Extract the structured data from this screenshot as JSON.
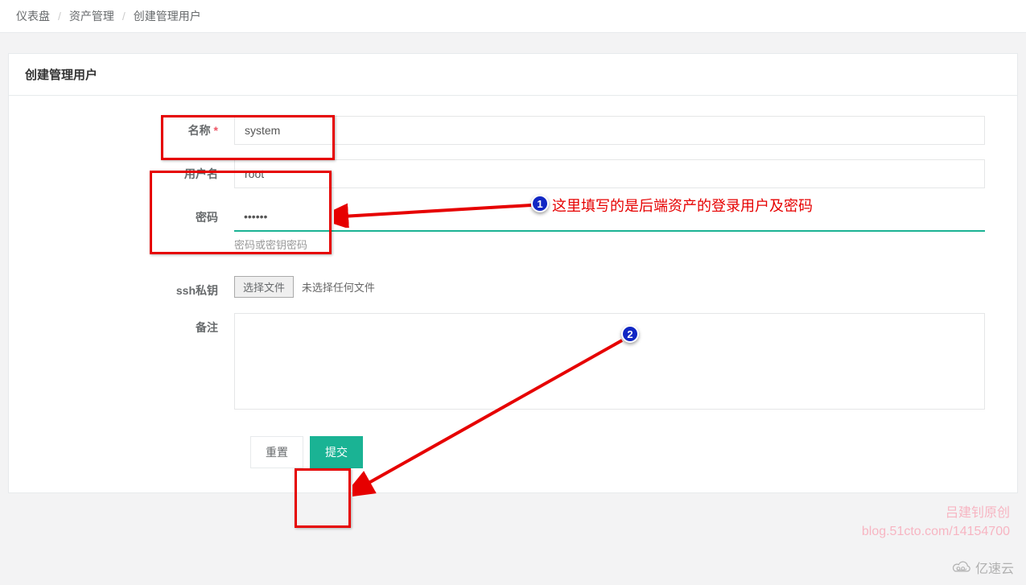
{
  "breadcrumb": {
    "dashboard": "仪表盘",
    "asset_mgmt": "资产管理",
    "current": "创建管理用户"
  },
  "panel": {
    "title": "创建管理用户"
  },
  "form": {
    "name_label": "名称",
    "name_value": "system",
    "username_label": "用户名",
    "username_value": "root",
    "password_label": "密码",
    "password_value": "••••••",
    "password_help": "密码或密钥密码",
    "sshkey_label": "ssh私钥",
    "file_button": "选择文件",
    "file_text": "未选择任何文件",
    "remark_label": "备注",
    "reset": "重置",
    "submit": "提交"
  },
  "annotations": {
    "note1": "这里填写的是后端资产的登录用户及密码",
    "marker1": "1",
    "marker2": "2"
  },
  "watermark": {
    "author_line1": "吕建钊原创",
    "author_line2": "blog.51cto.com/14154700",
    "site": "亿速云"
  }
}
